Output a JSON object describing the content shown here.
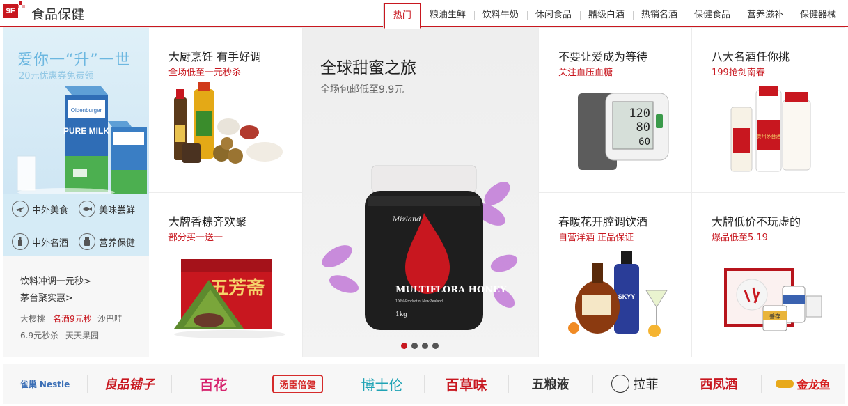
{
  "floor": {
    "badge": "9F",
    "title": "食品保健"
  },
  "tabs": [
    "热门",
    "粮油生鲜",
    "饮料牛奶",
    "休闲食品",
    "鼎级白酒",
    "热销名酒",
    "保健食品",
    "营养滋补",
    "保健器械"
  ],
  "sidebar": {
    "banner_title": "爱你一“升”一世",
    "banner_sub": "20元优惠券免费领",
    "milk_brand": "Oldenburger",
    "milk_text": "PURE MILK",
    "links": [
      "中外美食",
      "美味尝鲜",
      "中外名酒",
      "营养保健"
    ],
    "promos": [
      "饮料冲调一元秒>",
      "茅台聚实惠>"
    ],
    "tags_row1": [
      "大樱桃",
      "名酒9元秒",
      "沙巴哇"
    ],
    "tags_row2": [
      "6.9元秒杀",
      "天天果园"
    ]
  },
  "cells": {
    "grain": {
      "title": "大厨烹饪 有手好调",
      "sub": "全场低至一元秒杀"
    },
    "zongzi": {
      "title": "大牌香粽齐欢聚",
      "sub": "部分买一送一",
      "box_text": "五芳斋"
    },
    "honey": {
      "title": "全球甜蜜之旅",
      "sub": "全场包邮低至9.9元",
      "brand": "Mizland",
      "product": "MULTIFLORA HONEY",
      "origin": "100% Product of New Zealand",
      "weight": "1kg"
    },
    "bp": {
      "title": "不要让爱成为等待",
      "sub": "关注血压血糖",
      "readings": [
        "120",
        "80",
        "60"
      ]
    },
    "baijiu": {
      "title": "八大名酒任你挑",
      "sub": "199抢剑南春",
      "label": "贵州茅台酒"
    },
    "wine": {
      "title": "春暖花开腔调饮酒",
      "sub": "自营洋酒 正品保证",
      "label": "SKYY"
    },
    "bigbrand": {
      "title": "大牌低价不玩虚的",
      "sub": "爆品低至5.19",
      "label": "善存"
    }
  },
  "carousel": {
    "count": 4,
    "active": 0
  },
  "brands": [
    {
      "name": "雀巢 Nestle",
      "color": "#3b6fb6"
    },
    {
      "name": "良品铺子",
      "color": "#c8171f"
    },
    {
      "name": "百花",
      "color": "#d6246e"
    },
    {
      "name": "汤臣倍健",
      "color": "#d52b2b"
    },
    {
      "name": "博士伦",
      "color": "#1fa3b5"
    },
    {
      "name": "百草味",
      "color": "#c8171f"
    },
    {
      "name": "五粮液",
      "color": "#333333"
    },
    {
      "name": "拉菲",
      "color": "#222222"
    },
    {
      "name": "西凤酒",
      "color": "#c8171f"
    },
    {
      "name": "金龙鱼",
      "color": "#d61f1f"
    }
  ],
  "colors": {
    "accent": "#c8171f",
    "banner_blue": "#6cb7e0"
  }
}
